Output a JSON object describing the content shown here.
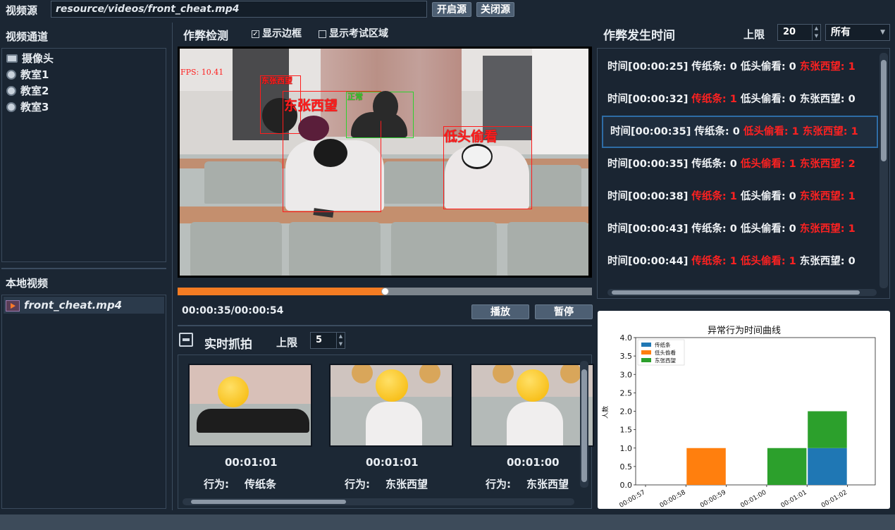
{
  "topbar": {
    "source_label": "视频源",
    "source_path": "resource/videos/front_cheat.mp4",
    "open_button": "开启源",
    "close_button": "关闭源"
  },
  "left": {
    "channels_title": "视频通道",
    "channels": [
      {
        "label": "摄像头",
        "icon": "camera-icon"
      },
      {
        "label": "教室1",
        "icon": "webcam-icon"
      },
      {
        "label": "教室2",
        "icon": "webcam-icon"
      },
      {
        "label": "教室3",
        "icon": "webcam-icon"
      }
    ],
    "local_title": "本地视频",
    "local_files": [
      {
        "label": "front_cheat.mp4",
        "icon": "video-file-icon"
      }
    ]
  },
  "detect": {
    "title": "作弊检测",
    "show_bbox_label": "显示边框",
    "show_bbox_checked": true,
    "show_exam_area_label": "显示考试区域",
    "show_exam_area_checked": false,
    "fps_text": "FPS: 10.41",
    "boxes": [
      {
        "label": "东张西望",
        "color": "#ff1c1c"
      },
      {
        "label": "东张西望",
        "color": "#ff1c1c"
      },
      {
        "label": "正常",
        "color": "#2fd12f"
      },
      {
        "label": "低头偷看",
        "color": "#ff1c1c"
      }
    ],
    "progress": 0.5,
    "time_display": "00:00:35/00:00:54",
    "play_button": "播放",
    "pause_button": "暂停"
  },
  "snapshot": {
    "title": "实时抓拍",
    "limit_label": "上限",
    "limit_value": "5",
    "items": [
      {
        "time": "00:01:01",
        "behavior_label": "行为:",
        "behavior": "传纸条"
      },
      {
        "time": "00:01:01",
        "behavior_label": "行为:",
        "behavior": "东张西望"
      },
      {
        "time": "00:01:00",
        "behavior_label": "行为:",
        "behavior": "东张西望"
      }
    ]
  },
  "events": {
    "title": "作弊发生时间",
    "limit_label": "上限",
    "limit_value": "20",
    "filter_value": "所有",
    "records": [
      {
        "time": "时间[00:00:25]",
        "a": "传纸条: 0",
        "a_hit": false,
        "b": "低头偷看: 0",
        "b_hit": false,
        "c": "东张西望: 1",
        "c_hit": true
      },
      {
        "time": "时间[00:00:32]",
        "a": "传纸条: 1",
        "a_hit": true,
        "b": "低头偷看: 0",
        "b_hit": false,
        "c": "东张西望: 0",
        "c_hit": false
      },
      {
        "time": "时间[00:00:35]",
        "a": "传纸条: 0",
        "a_hit": false,
        "b": "低头偷看: 1",
        "b_hit": true,
        "c": "东张西望: 1",
        "c_hit": true
      },
      {
        "time": "时间[00:00:35]",
        "a": "传纸条: 0",
        "a_hit": false,
        "b": "低头偷看: 1",
        "b_hit": true,
        "c": "东张西望: 2",
        "c_hit": true
      },
      {
        "time": "时间[00:00:38]",
        "a": "传纸条: 1",
        "a_hit": true,
        "b": "低头偷看: 0",
        "b_hit": false,
        "c": "东张西望: 1",
        "c_hit": true
      },
      {
        "time": "时间[00:00:43]",
        "a": "传纸条: 0",
        "a_hit": false,
        "b": "低头偷看: 0",
        "b_hit": false,
        "c": "东张西望: 1",
        "c_hit": true
      },
      {
        "time": "时间[00:00:44]",
        "a": "传纸条: 1",
        "a_hit": true,
        "b": "低头偷看: 1",
        "b_hit": true,
        "c": "东张西望: 0",
        "c_hit": false
      }
    ],
    "selected_index": 2
  },
  "chart_data": {
    "type": "bar",
    "stacked": true,
    "title": "异常行为时间曲线",
    "ylabel": "人数",
    "xlabel": "",
    "categories": [
      "00:00:57",
      "00:00:58",
      "00:00:59",
      "00:01:00",
      "00:01:01",
      "00:01:02"
    ],
    "series": [
      {
        "name": "传纸条",
        "color": "#1f77b4",
        "values": [
          0,
          0,
          0,
          0,
          1,
          0
        ]
      },
      {
        "name": "低头偷看",
        "color": "#ff7f0e",
        "values": [
          0,
          1,
          0,
          0,
          0,
          0
        ]
      },
      {
        "name": "东张西望",
        "color": "#2ca02c",
        "values": [
          0,
          0,
          0,
          1,
          1,
          0
        ]
      }
    ],
    "ylim": [
      0,
      4.0
    ],
    "yticks": [
      "0.0",
      "0.5",
      "1.0",
      "1.5",
      "2.0",
      "2.5",
      "3.0",
      "3.5",
      "4.0"
    ],
    "legend_position": "top-left"
  }
}
